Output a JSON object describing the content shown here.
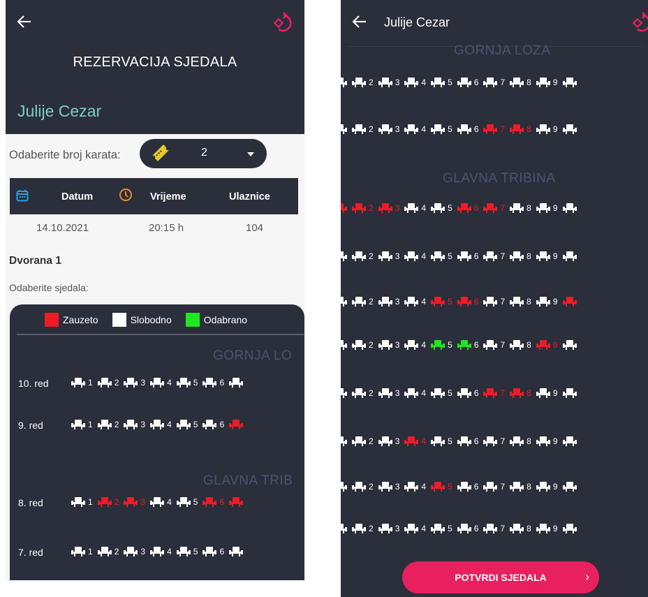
{
  "colors": {
    "taken": "#ee1c25",
    "free": "#ffffff",
    "chosen": "#1ee81e",
    "accent": "#e8205f",
    "teal": "#79d0c4",
    "panel": "#2b2e3b"
  },
  "left": {
    "title": "REZERVACIJA SJEDALA",
    "movie": "Julije Cezar",
    "count_label": "Odaberite broj karata:",
    "count_value": "2",
    "table": {
      "date_h": "Datum",
      "time_h": "Vrijeme",
      "tickets_h": "Ulaznice",
      "date": "14.10.2021",
      "time": "20:15 h",
      "tickets": "104"
    },
    "hall": "Dvorana 1",
    "pick_label": "Odaberite sjedala:",
    "legend": {
      "taken": "Zauzeto",
      "free": "Slobodno",
      "chosen": "Odabrano"
    },
    "section_upper": "GORNJA LO",
    "section_main": "GLAVNA TRIB",
    "rows": [
      {
        "label": "10. red",
        "seats": [
          {
            "n": "1",
            "s": "free"
          },
          {
            "n": "2",
            "s": "free"
          },
          {
            "n": "3",
            "s": "free"
          },
          {
            "n": "4",
            "s": "free"
          },
          {
            "n": "5",
            "s": "free"
          },
          {
            "n": "6",
            "s": "free"
          },
          {
            "n": "",
            "s": "free"
          }
        ]
      },
      {
        "label": "9. red",
        "seats": [
          {
            "n": "1",
            "s": "free"
          },
          {
            "n": "2",
            "s": "free"
          },
          {
            "n": "3",
            "s": "free"
          },
          {
            "n": "4",
            "s": "free"
          },
          {
            "n": "5",
            "s": "free"
          },
          {
            "n": "6",
            "s": "free"
          },
          {
            "n": "",
            "s": "taken"
          }
        ]
      },
      {
        "label": "8. red",
        "seats": [
          {
            "n": "1",
            "s": "free"
          },
          {
            "n": "2",
            "s": "taken"
          },
          {
            "n": "3",
            "s": "taken"
          },
          {
            "n": "4",
            "s": "free"
          },
          {
            "n": "5",
            "s": "free"
          },
          {
            "n": "6",
            "s": "taken"
          },
          {
            "n": "",
            "s": "taken"
          }
        ]
      },
      {
        "label": "7. red",
        "seats": [
          {
            "n": "1",
            "s": "free"
          },
          {
            "n": "2",
            "s": "free"
          },
          {
            "n": "3",
            "s": "free"
          },
          {
            "n": "4",
            "s": "free"
          },
          {
            "n": "5",
            "s": "free"
          },
          {
            "n": "6",
            "s": "free"
          },
          {
            "n": "",
            "s": "free"
          }
        ]
      }
    ]
  },
  "right": {
    "title": "Julije Cezar",
    "section_upper": "GORNJA LOZA",
    "section_main": "GLAVNA TRIBINA",
    "button": "POTVRDI SJEDALA",
    "button_icon": "chevron-right-icon",
    "rows": [
      {
        "first": "free",
        "seats": [
          {
            "n": "2",
            "s": "free"
          },
          {
            "n": "3",
            "s": "free"
          },
          {
            "n": "4",
            "s": "free"
          },
          {
            "n": "5",
            "s": "free"
          },
          {
            "n": "6",
            "s": "free"
          },
          {
            "n": "7",
            "s": "free"
          },
          {
            "n": "8",
            "s": "free"
          },
          {
            "n": "9",
            "s": "free"
          },
          {
            "n": "",
            "s": "free"
          }
        ]
      },
      {
        "first": "free",
        "seats": [
          {
            "n": "2",
            "s": "free"
          },
          {
            "n": "3",
            "s": "free"
          },
          {
            "n": "4",
            "s": "free"
          },
          {
            "n": "5",
            "s": "free"
          },
          {
            "n": "6",
            "s": "free"
          },
          {
            "n": "7",
            "s": "taken"
          },
          {
            "n": "8",
            "s": "taken"
          },
          {
            "n": "9",
            "s": "free"
          },
          {
            "n": "",
            "s": "free"
          }
        ]
      },
      {
        "first": "taken",
        "seats": [
          {
            "n": "2",
            "s": "taken"
          },
          {
            "n": "3",
            "s": "taken"
          },
          {
            "n": "4",
            "s": "free"
          },
          {
            "n": "5",
            "s": "free"
          },
          {
            "n": "6",
            "s": "taken"
          },
          {
            "n": "7",
            "s": "taken"
          },
          {
            "n": "8",
            "s": "free"
          },
          {
            "n": "9",
            "s": "free"
          },
          {
            "n": "",
            "s": "free"
          }
        ]
      },
      {
        "first": "free",
        "seats": [
          {
            "n": "2",
            "s": "free"
          },
          {
            "n": "3",
            "s": "free"
          },
          {
            "n": "4",
            "s": "free"
          },
          {
            "n": "5",
            "s": "free"
          },
          {
            "n": "6",
            "s": "free"
          },
          {
            "n": "7",
            "s": "free"
          },
          {
            "n": "8",
            "s": "free"
          },
          {
            "n": "9",
            "s": "free"
          },
          {
            "n": "",
            "s": "free"
          }
        ]
      },
      {
        "first": "free",
        "seats": [
          {
            "n": "2",
            "s": "free"
          },
          {
            "n": "3",
            "s": "free"
          },
          {
            "n": "4",
            "s": "free"
          },
          {
            "n": "5",
            "s": "taken"
          },
          {
            "n": "6",
            "s": "taken"
          },
          {
            "n": "7",
            "s": "free"
          },
          {
            "n": "8",
            "s": "free"
          },
          {
            "n": "9",
            "s": "free"
          },
          {
            "n": "",
            "s": "taken"
          }
        ]
      },
      {
        "first": "free",
        "seats": [
          {
            "n": "2",
            "s": "free"
          },
          {
            "n": "3",
            "s": "free"
          },
          {
            "n": "4",
            "s": "free"
          },
          {
            "n": "5",
            "s": "chosen"
          },
          {
            "n": "6",
            "s": "chosen"
          },
          {
            "n": "7",
            "s": "free"
          },
          {
            "n": "8",
            "s": "free"
          },
          {
            "n": "9",
            "s": "taken"
          },
          {
            "n": "",
            "s": "free"
          }
        ]
      },
      {
        "first": "free",
        "seats": [
          {
            "n": "2",
            "s": "free"
          },
          {
            "n": "3",
            "s": "free"
          },
          {
            "n": "4",
            "s": "free"
          },
          {
            "n": "5",
            "s": "free"
          },
          {
            "n": "6",
            "s": "free"
          },
          {
            "n": "7",
            "s": "taken"
          },
          {
            "n": "8",
            "s": "taken"
          },
          {
            "n": "9",
            "s": "free"
          },
          {
            "n": "",
            "s": "free"
          }
        ]
      },
      {
        "first": "free",
        "seats": [
          {
            "n": "2",
            "s": "free"
          },
          {
            "n": "3",
            "s": "free"
          },
          {
            "n": "4",
            "s": "taken"
          },
          {
            "n": "5",
            "s": "free"
          },
          {
            "n": "6",
            "s": "free"
          },
          {
            "n": "7",
            "s": "free"
          },
          {
            "n": "8",
            "s": "free"
          },
          {
            "n": "9",
            "s": "free"
          },
          {
            "n": "",
            "s": "free"
          }
        ]
      },
      {
        "first": "free",
        "seats": [
          {
            "n": "2",
            "s": "free"
          },
          {
            "n": "3",
            "s": "free"
          },
          {
            "n": "4",
            "s": "free"
          },
          {
            "n": "5",
            "s": "taken"
          },
          {
            "n": "6",
            "s": "free"
          },
          {
            "n": "7",
            "s": "free"
          },
          {
            "n": "8",
            "s": "free"
          },
          {
            "n": "9",
            "s": "free"
          },
          {
            "n": "",
            "s": "free"
          }
        ]
      },
      {
        "first": "free",
        "seats": [
          {
            "n": "2",
            "s": "free"
          },
          {
            "n": "3",
            "s": "free"
          },
          {
            "n": "4",
            "s": "free"
          },
          {
            "n": "5",
            "s": "free"
          },
          {
            "n": "6",
            "s": "free"
          },
          {
            "n": "7",
            "s": "free"
          },
          {
            "n": "8",
            "s": "free"
          },
          {
            "n": "9",
            "s": "free"
          },
          {
            "n": "",
            "s": "free"
          }
        ]
      }
    ]
  }
}
